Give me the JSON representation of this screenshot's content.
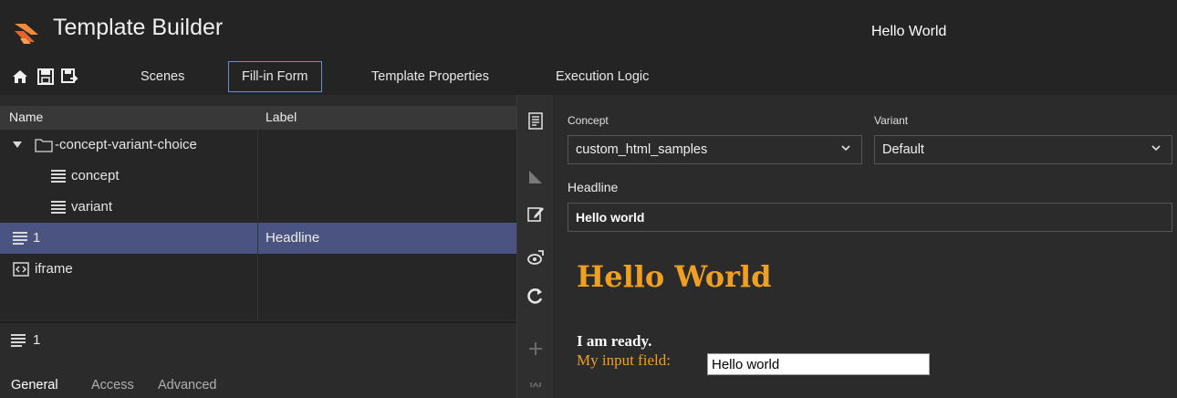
{
  "app": {
    "title": "Template Builder",
    "scene_title": "Hello World"
  },
  "toolbar": {
    "icons": [
      "home-icon",
      "save-icon",
      "save-as-icon"
    ],
    "tabs": [
      {
        "label": "Scenes",
        "active": false
      },
      {
        "label": "Fill-in Form",
        "active": true
      },
      {
        "label": "Template Properties",
        "active": false
      },
      {
        "label": "Execution Logic",
        "active": false
      }
    ]
  },
  "tree": {
    "headers": {
      "name": "Name",
      "label": "Label"
    },
    "rows": [
      {
        "name": "-concept-variant-choice",
        "label": "",
        "icon": "folder-icon",
        "expanded": true
      },
      {
        "name": "concept",
        "label": "",
        "icon": "text-field-icon"
      },
      {
        "name": "variant",
        "label": "",
        "icon": "text-field-icon"
      },
      {
        "name": "1",
        "label": "Headline",
        "icon": "text-field-icon",
        "selected": true
      },
      {
        "name": "iframe",
        "label": "",
        "icon": "iframe-icon"
      }
    ]
  },
  "properties": {
    "selected_name": "1",
    "tabs": [
      {
        "label": "General",
        "active": true
      },
      {
        "label": "Access",
        "active": false
      },
      {
        "label": "Advanced",
        "active": false
      }
    ]
  },
  "vertical_tools": [
    "form-icon",
    "ruler-icon",
    "edit-icon",
    "preview-icon",
    "refresh-icon",
    "add-icon",
    "collapse-icon"
  ],
  "form": {
    "concept": {
      "label": "Concept",
      "value": "custom_html_samples"
    },
    "variant": {
      "label": "Variant",
      "value": "Default"
    },
    "headline": {
      "label": "Headline",
      "value": "Hello world"
    }
  },
  "preview": {
    "title": "Hello World",
    "ready_text": "I am ready.",
    "input_label": "My input field:",
    "input_value": "Hello world"
  },
  "colors": {
    "accent": "#6a8fd6",
    "selection": "#4b5380",
    "preview_orange": "#f0a020"
  }
}
